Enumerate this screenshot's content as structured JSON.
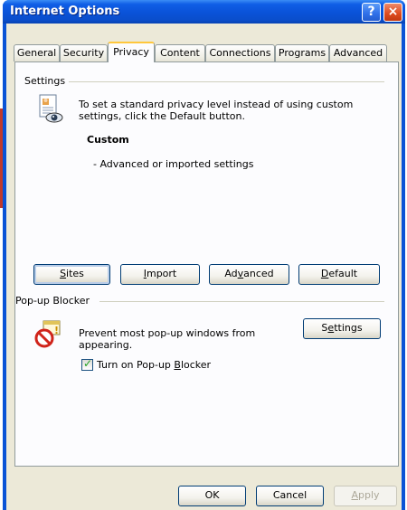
{
  "window": {
    "title": "Internet Options",
    "help_glyph": "?",
    "close_glyph": "×"
  },
  "tabs": [
    {
      "label": "General"
    },
    {
      "label": "Security"
    },
    {
      "label": "Privacy",
      "active": true
    },
    {
      "label": "Content"
    },
    {
      "label": "Connections"
    },
    {
      "label": "Programs"
    },
    {
      "label": "Advanced"
    }
  ],
  "settings": {
    "group_label": "Settings",
    "icon": "privacy-settings-icon",
    "description_line1": "To set a standard privacy level instead of using custom",
    "description_line2": "settings, click the Default button.",
    "level_title": "Custom",
    "level_detail": "- Advanced or imported settings",
    "buttons": {
      "sites": {
        "pre": "",
        "accel": "S",
        "post": "ites"
      },
      "import": {
        "pre": "",
        "accel": "I",
        "post": "mport"
      },
      "advanced": {
        "pre": "Ad",
        "accel": "v",
        "post": "anced"
      },
      "default": {
        "pre": "",
        "accel": "D",
        "post": "efault"
      }
    }
  },
  "popup_blocker": {
    "group_label": "Pop-up Blocker",
    "icon": "popup-blocked-icon",
    "description_line1": "Prevent most pop-up windows from",
    "description_line2": "appearing.",
    "settings_button": {
      "pre": "S",
      "accel": "e",
      "post": "ttings"
    },
    "checkbox": {
      "pre": "Turn on Pop-up ",
      "accel": "B",
      "post": "locker",
      "checked": true
    }
  },
  "footer": {
    "ok_label": "OK",
    "cancel_label": "Cancel",
    "apply": {
      "pre": "",
      "accel": "A",
      "post": "pply",
      "disabled": true
    }
  }
}
